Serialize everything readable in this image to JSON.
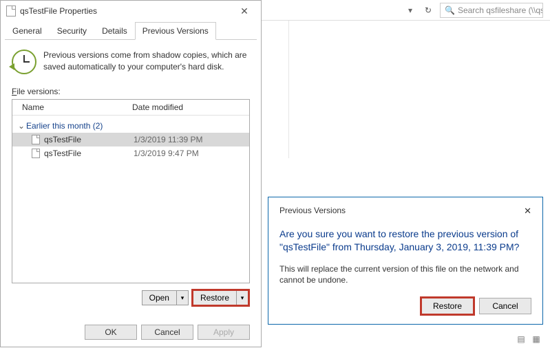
{
  "explorer": {
    "search_placeholder": "Search qsfileshare (\\\\qsstorag..."
  },
  "dialog": {
    "title": "qsTestFile Properties",
    "tabs": [
      "General",
      "Security",
      "Details",
      "Previous Versions"
    ],
    "active_tab": 3,
    "info_text": "Previous versions come from shadow copies, which are saved automatically to your computer's hard disk.",
    "file_versions_label": "File versions:",
    "columns": {
      "name": "Name",
      "date": "Date modified"
    },
    "group": {
      "label": "Earlier this month",
      "count": "(2)"
    },
    "items": [
      {
        "name": "qsTestFile",
        "date": "1/3/2019 11:39 PM",
        "selected": true
      },
      {
        "name": "qsTestFile",
        "date": "1/3/2019 9:47 PM",
        "selected": false
      }
    ],
    "buttons": {
      "open": "Open",
      "restore": "Restore"
    },
    "footer": {
      "ok": "OK",
      "cancel": "Cancel",
      "apply": "Apply"
    }
  },
  "confirm": {
    "title": "Previous Versions",
    "message": "Are you sure you want to restore the previous version of \"qsTestFile\" from Thursday, January 3, 2019, 11:39 PM?",
    "subtext": "This will replace the current version of this file on the network and cannot be undone.",
    "restore": "Restore",
    "cancel": "Cancel"
  }
}
